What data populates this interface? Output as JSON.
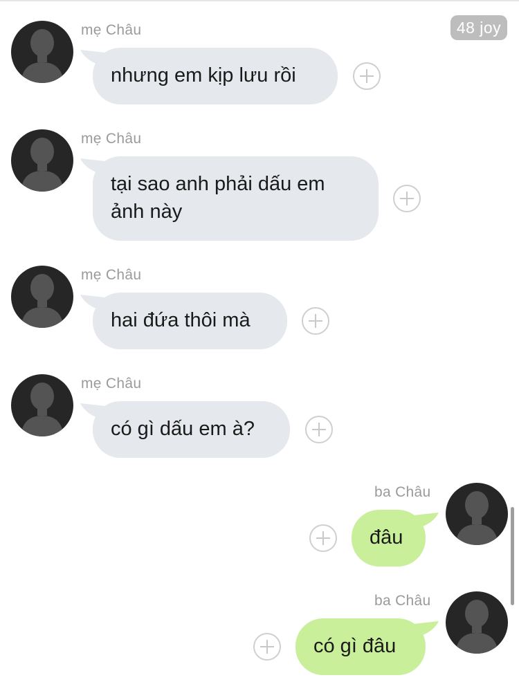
{
  "header": {
    "badge_text": "48 joy"
  },
  "messages": [
    {
      "sender": "mẹ Châu",
      "text": "nhưng em kịp lưu rồi",
      "direction": "incoming"
    },
    {
      "sender": "mẹ Châu",
      "text": "tại sao anh phải dấu em ảnh này",
      "direction": "incoming"
    },
    {
      "sender": "mẹ Châu",
      "text": "hai đứa thôi mà",
      "direction": "incoming"
    },
    {
      "sender": "mẹ Châu",
      "text": "có gì dấu em à?",
      "direction": "incoming"
    },
    {
      "sender": "ba Châu",
      "text": "đâu",
      "direction": "outgoing"
    },
    {
      "sender": "ba Châu",
      "text": "có gì đâu",
      "direction": "outgoing"
    }
  ],
  "icons": {
    "avatar": "default-person-silhouette",
    "reaction": "add-reaction-plus-icon"
  },
  "colors": {
    "incoming_bubble": "#e5e8ec",
    "outgoing_bubble": "#c9ef9a",
    "sender_text": "#9a9a9a",
    "avatar_bg": "#262626",
    "badge_bg": "#bdbdbd"
  }
}
